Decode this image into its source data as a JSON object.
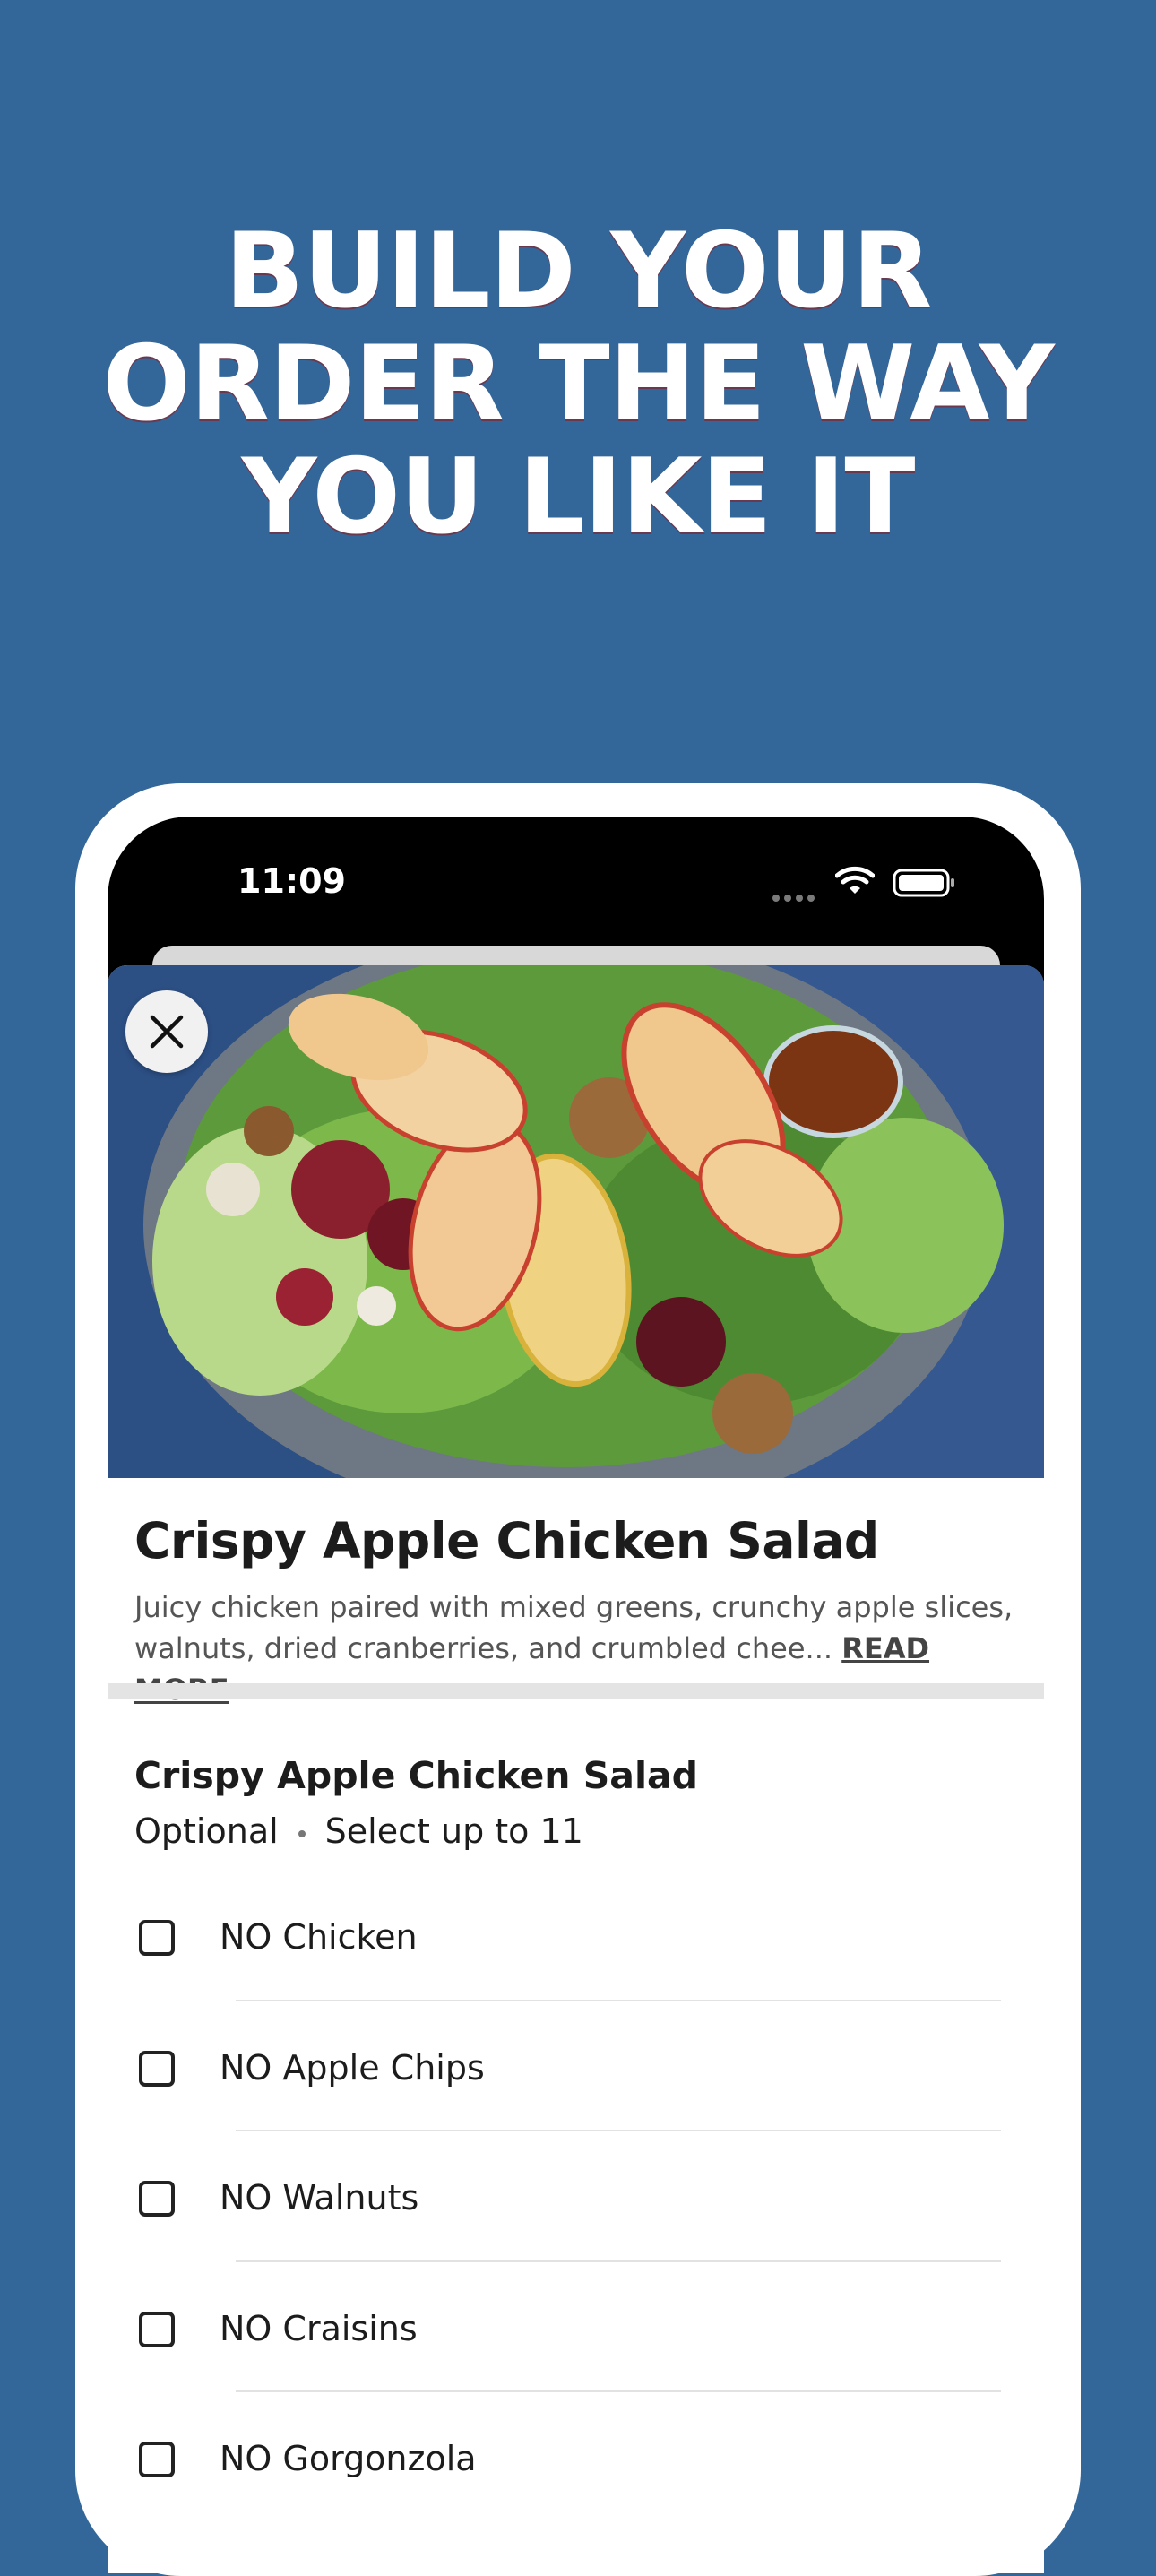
{
  "headline": [
    "BUILD YOUR",
    "ORDER THE WAY",
    "YOU LIKE IT"
  ],
  "status_bar": {
    "time": "11:09"
  },
  "item": {
    "title": "Crispy Apple Chicken Salad",
    "description_line1": "Juicy chicken paired with mixed greens, crunchy apple slices,",
    "description_line2": "walnuts, dried cranberries, and crumbled chee...",
    "read_more": "READ MORE"
  },
  "modifier_group": {
    "title": "Crispy Apple Chicken Salad",
    "required": "Optional",
    "limit": "Select up to 11",
    "options": [
      {
        "label": "NO Chicken",
        "checked": false
      },
      {
        "label": "NO Apple Chips",
        "checked": false
      },
      {
        "label": "NO Walnuts",
        "checked": false
      },
      {
        "label": "NO Craisins",
        "checked": false
      },
      {
        "label": "NO Gorgonzola",
        "checked": false
      }
    ]
  },
  "colors": {
    "background": "#336699",
    "text": "#1c1c1c"
  },
  "icons": [
    "close-icon",
    "wifi-icon",
    "battery-icon",
    "checkbox-icon"
  ]
}
